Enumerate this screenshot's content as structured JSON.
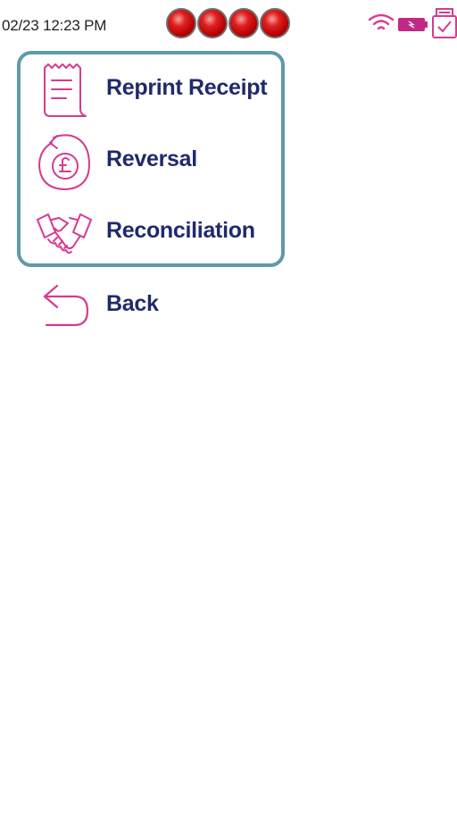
{
  "status_bar": {
    "datetime": "02/23 12:23 PM",
    "led_color": "#e02020",
    "icons": [
      "wifi-icon",
      "battery-icon",
      "receipt-printer-icon"
    ],
    "accent_color": "#d63b8f"
  },
  "menu": {
    "border_color": "#5f9aab",
    "text_color": "#1f2a6b",
    "icon_color": "#d63b8f",
    "items": [
      {
        "label": "Reprint Receipt",
        "icon": "receipt-icon"
      },
      {
        "label": "Reversal",
        "icon": "pound-reversal-icon"
      },
      {
        "label": "Reconciliation",
        "icon": "handshake-icon"
      }
    ]
  },
  "back": {
    "label": "Back",
    "icon": "back-arrow-icon"
  }
}
